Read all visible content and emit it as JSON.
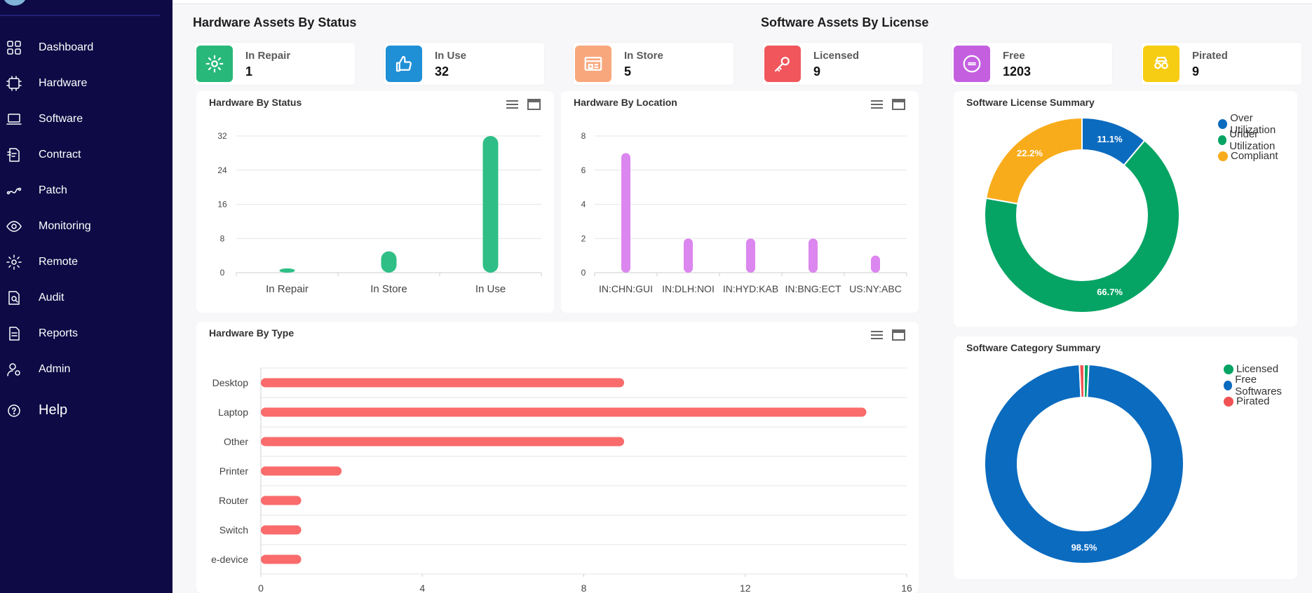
{
  "sidebar": {
    "items": [
      {
        "label": "Dashboard",
        "icon": "grid-icon"
      },
      {
        "label": "Hardware",
        "icon": "chip-icon"
      },
      {
        "label": "Software",
        "icon": "laptop-icon"
      },
      {
        "label": "Contract",
        "icon": "contract-icon"
      },
      {
        "label": "Patch",
        "icon": "patch-icon"
      },
      {
        "label": "Monitoring",
        "icon": "eye-icon"
      },
      {
        "label": "Remote",
        "icon": "gear-icon"
      },
      {
        "label": "Audit",
        "icon": "audit-icon"
      },
      {
        "label": "Reports",
        "icon": "report-icon"
      },
      {
        "label": "Admin",
        "icon": "admin-icon"
      }
    ],
    "help": {
      "label": "Help",
      "icon": "help-icon"
    }
  },
  "hardware_section": {
    "title": "Hardware Assets By Status",
    "stats": [
      {
        "label": "In Repair",
        "value": "1",
        "color": "#27b87a",
        "icon": "gear-icon"
      },
      {
        "label": "In Use",
        "value": "32",
        "color": "#1f8fd6",
        "icon": "thumbs-up-icon"
      },
      {
        "label": "In Store",
        "value": "5",
        "color": "#f8a77c",
        "icon": "store-icon"
      }
    ]
  },
  "software_section": {
    "title": "Software Assets By License",
    "stats": [
      {
        "label": "Licensed",
        "value": "9",
        "color": "#f0565b",
        "icon": "key-icon"
      },
      {
        "label": "Free",
        "value": "1203",
        "color": "#c45fe0",
        "icon": "free-badge-icon"
      },
      {
        "label": "Pirated",
        "value": "9",
        "color": "#f7cd13",
        "icon": "pirate-icon"
      }
    ]
  },
  "cards": {
    "hw_status": {
      "title": "Hardware By Status"
    },
    "hw_location": {
      "title": "Hardware By Location"
    },
    "hw_type": {
      "title": "Hardware By Type"
    },
    "sw_license": {
      "title": "Software License Summary"
    },
    "sw_category": {
      "title": "Software Category Summary"
    }
  },
  "chart_data": [
    {
      "id": "hw_status",
      "type": "bar",
      "title": "Hardware By Status",
      "categories": [
        "In Repair",
        "In Store",
        "In Use"
      ],
      "values": [
        1,
        5,
        32
      ],
      "ylim": [
        0,
        32
      ],
      "yticks": [
        0,
        8,
        16,
        24,
        32
      ],
      "grid": true,
      "color": "#2fbf86"
    },
    {
      "id": "hw_location",
      "type": "bar",
      "title": "Hardware By Location",
      "categories": [
        "IN:CHN:GUI",
        "IN:DLH:NOI",
        "IN:HYD:KAB",
        "IN:BNG:ECT",
        "US:NY:ABC"
      ],
      "values": [
        7,
        2,
        2,
        2,
        1
      ],
      "ylim": [
        0,
        8
      ],
      "yticks": [
        0,
        2,
        4,
        6,
        8
      ],
      "grid": true,
      "color": "#dc86ef"
    },
    {
      "id": "hw_type",
      "type": "bar",
      "orientation": "horizontal",
      "title": "Hardware By Type",
      "categories": [
        "Desktop",
        "Laptop",
        "Other",
        "Printer",
        "Router",
        "Switch",
        "e-device"
      ],
      "values": [
        9,
        15,
        9,
        2,
        1,
        1,
        1
      ],
      "xlim": [
        0,
        16
      ],
      "xticks": [
        0,
        4,
        8,
        12,
        16
      ],
      "grid": true,
      "color": "#fa6b6b"
    },
    {
      "id": "sw_license",
      "type": "pie",
      "title": "Software License Summary",
      "labels": [
        "Over Utilization",
        "Under Utilization",
        "Compliant"
      ],
      "values": [
        11.1,
        66.7,
        22.2
      ],
      "display": [
        "11.1%",
        "66.7%",
        "22.2%"
      ],
      "colors": [
        "#0b6bbf",
        "#05a464",
        "#f9ac1b"
      ],
      "legend": "top-right"
    },
    {
      "id": "sw_category",
      "type": "pie",
      "title": "Software Category Summary",
      "labels": [
        "Licensed",
        "Free Softwares",
        "Pirated"
      ],
      "values": [
        0.75,
        98.5,
        0.75
      ],
      "display": [
        "",
        "98.5%",
        ""
      ],
      "colors": [
        "#05a464",
        "#0b6bbf",
        "#f05254"
      ],
      "legend": "top-right"
    }
  ]
}
